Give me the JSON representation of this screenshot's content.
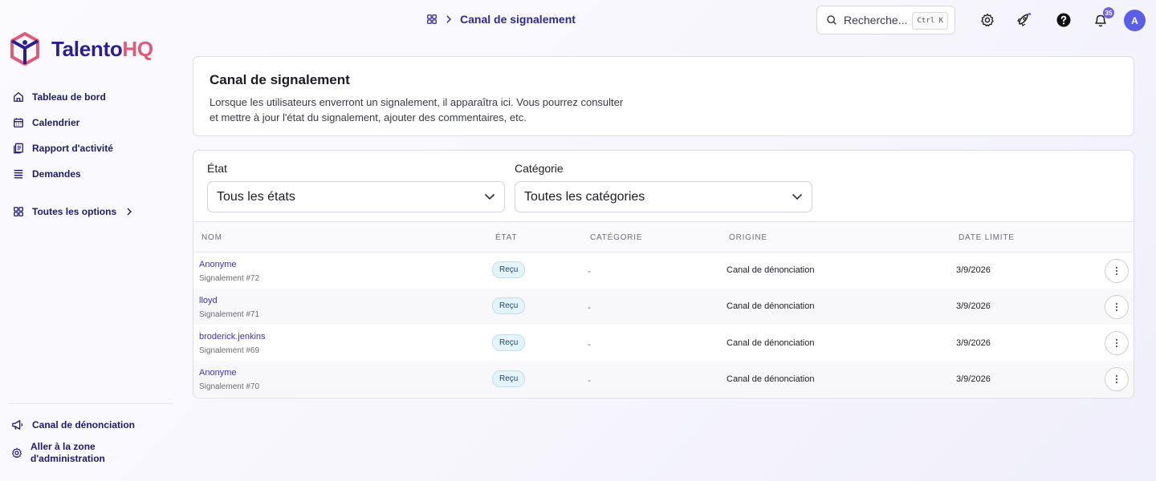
{
  "brand": {
    "name_part1": "Talento",
    "name_part2": "HQ",
    "color_primary": "#2b1f8f",
    "color_accent": "#e05a7a"
  },
  "sidebar": {
    "items": [
      {
        "label": "Tableau de bord",
        "icon": "home-icon"
      },
      {
        "label": "Calendrier",
        "icon": "calendar-icon"
      },
      {
        "label": "Rapport d'activité",
        "icon": "report-icon"
      },
      {
        "label": "Demandes",
        "icon": "list-icon"
      },
      {
        "label": "Toutes les options",
        "icon": "grid-icon"
      }
    ],
    "bottom": [
      {
        "label": "Canal de dénonciation",
        "icon": "megaphone-icon"
      },
      {
        "label_line1": "Aller à la zone",
        "label_line2": "d'administration",
        "icon": "gear-icon"
      }
    ]
  },
  "topbar": {
    "breadcrumb": "Canal de signalement",
    "search_placeholder": "Recherche...",
    "search_shortcut": "Ctrl K",
    "notification_count": "35",
    "avatar_initial": "A"
  },
  "header": {
    "title": "Canal de signalement",
    "description_line1": "Lorsque les utilisateurs enverront un signalement, il apparaîtra ici. Vous pourrez consulter",
    "description_line2": "et mettre à jour l'état du signalement, ajouter des commentaires, etc."
  },
  "filters": {
    "state_label": "État",
    "state_value": "Tous les états",
    "category_label": "Catégorie",
    "category_value": "Toutes les catégories"
  },
  "table": {
    "columns": [
      "NOM",
      "ÉTAT",
      "CATÉGORIE",
      "ORIGINE",
      "DATE LIMITE"
    ],
    "rows": [
      {
        "name": "Anonyme",
        "sub": "Signalement #72",
        "status": "Reçu",
        "category": "-",
        "origin": "Canal de dénonciation",
        "deadline": "3/9/2026"
      },
      {
        "name": "lloyd",
        "sub": "Signalement #71",
        "status": "Reçu",
        "category": "-",
        "origin": "Canal de dénonciation",
        "deadline": "3/9/2026"
      },
      {
        "name": "broderick.jenkins",
        "sub": "Signalement #69",
        "status": "Reçu",
        "category": "-",
        "origin": "Canal de dénonciation",
        "deadline": "3/9/2026"
      },
      {
        "name": "Anonyme",
        "sub": "Signalement #70",
        "status": "Reçu",
        "category": "-",
        "origin": "Canal de dénonciation",
        "deadline": "3/9/2026"
      }
    ]
  }
}
